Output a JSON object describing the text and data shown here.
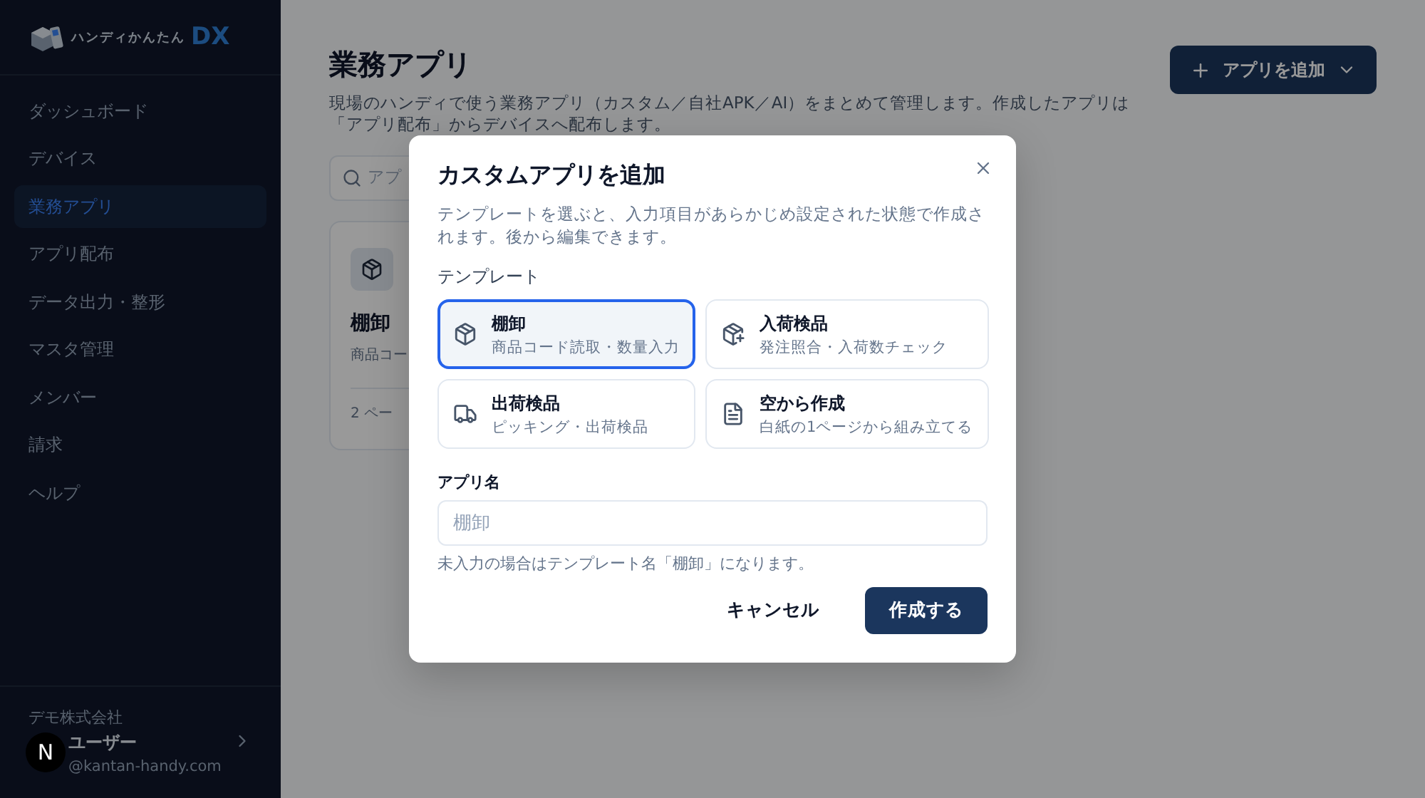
{
  "brand": {
    "name": "ハンディかんたん",
    "suffix": "DX"
  },
  "sidebar": {
    "items": [
      {
        "label": "ダッシュボード",
        "selected": false
      },
      {
        "label": "デバイス",
        "selected": false
      },
      {
        "label": "業務アプリ",
        "selected": true
      },
      {
        "label": "アプリ配布",
        "selected": false
      },
      {
        "label": "データ出力・整形",
        "selected": false
      },
      {
        "label": "マスタ管理",
        "selected": false
      },
      {
        "label": "メンバー",
        "selected": false
      },
      {
        "label": "請求",
        "selected": false
      },
      {
        "label": "ヘルプ",
        "selected": false
      }
    ],
    "account": {
      "company": "デモ株式会社",
      "user": "ユーザー",
      "email": "@kantan-handy.com",
      "avatar": "N"
    }
  },
  "header": {
    "title": "業務アプリ",
    "description": "現場のハンディで使う業務アプリ（カスタム／自社APK／AI）をまとめて管理します。作成したアプリは「アプリ配布」からデバイスへ配布します。",
    "add_button": "アプリを追加"
  },
  "search": {
    "placeholder": "アプ"
  },
  "app_card": {
    "title": "棚卸",
    "subtitle": "商品コー",
    "meta": "2 ペー"
  },
  "dialog": {
    "title": "カスタムアプリを追加",
    "description": "テンプレートを選ぶと、入力項目があらかじめ設定された状態で作成されます。後から編集できます。",
    "template_label": "テンプレート",
    "templates": [
      {
        "kind": "box",
        "name": "棚卸",
        "detail": "商品コード読取・数量入力",
        "selected": true
      },
      {
        "kind": "box-plus",
        "name": "入荷検品",
        "detail": "発注照合・入荷数チェック",
        "selected": false
      },
      {
        "kind": "truck",
        "name": "出荷検品",
        "detail": "ピッキング・出荷検品",
        "selected": false
      },
      {
        "kind": "file",
        "name": "空から作成",
        "detail": "白紙の1ページから組み立てる",
        "selected": false
      }
    ],
    "name_label": "アプリ名",
    "name_placeholder": "棚卸",
    "hint": "未入力の場合はテンプレート名「棚卸」になります。",
    "buttons": {
      "cancel": "キャンセル",
      "create": "作成する"
    }
  }
}
